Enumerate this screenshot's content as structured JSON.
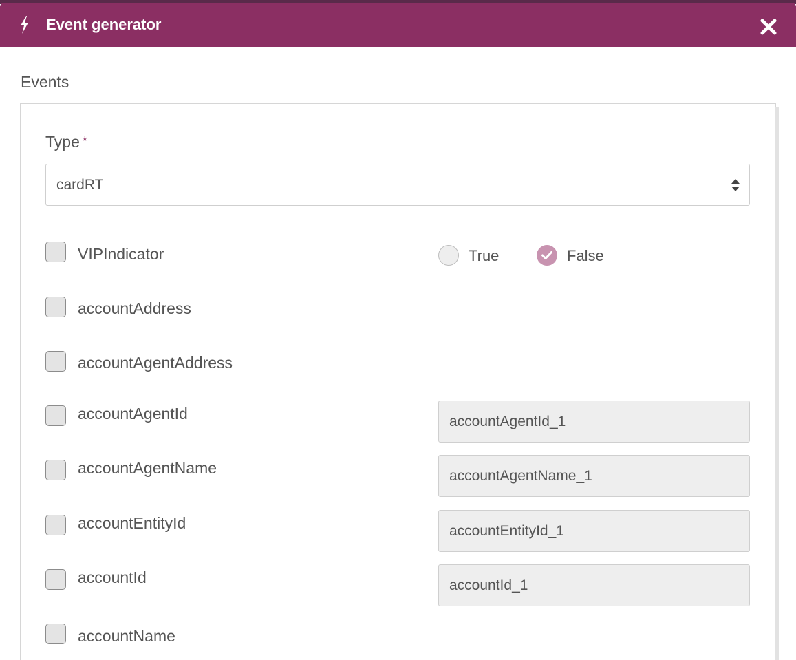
{
  "dialog": {
    "title": "Event generator",
    "icons": {
      "title_icon": "bolt-icon",
      "close_icon": "close-icon"
    },
    "colors": {
      "header_bg": "#8b2f63",
      "accent": "#8b2f63",
      "radio_checked": "#c893b0"
    }
  },
  "events": {
    "section_title": "Events",
    "type_field": {
      "label": "Type",
      "required_marker": "*",
      "selected_value": "cardRT"
    },
    "fields": [
      {
        "name": "VIPIndicator",
        "checked": false,
        "kind": "boolean",
        "options": [
          {
            "label": "True",
            "selected": false
          },
          {
            "label": "False",
            "selected": true
          }
        ]
      },
      {
        "name": "accountAddress",
        "checked": false,
        "kind": "none"
      },
      {
        "name": "accountAgentAddress",
        "checked": false,
        "kind": "none"
      },
      {
        "name": "accountAgentId",
        "checked": false,
        "kind": "text",
        "value": "accountAgentId_1"
      },
      {
        "name": "accountAgentName",
        "checked": false,
        "kind": "text",
        "value": "accountAgentName_1"
      },
      {
        "name": "accountEntityId",
        "checked": false,
        "kind": "text",
        "value": "accountEntityId_1"
      },
      {
        "name": "accountId",
        "checked": false,
        "kind": "text",
        "value": "accountId_1"
      },
      {
        "name": "accountName",
        "checked": false,
        "kind": "none"
      }
    ]
  }
}
